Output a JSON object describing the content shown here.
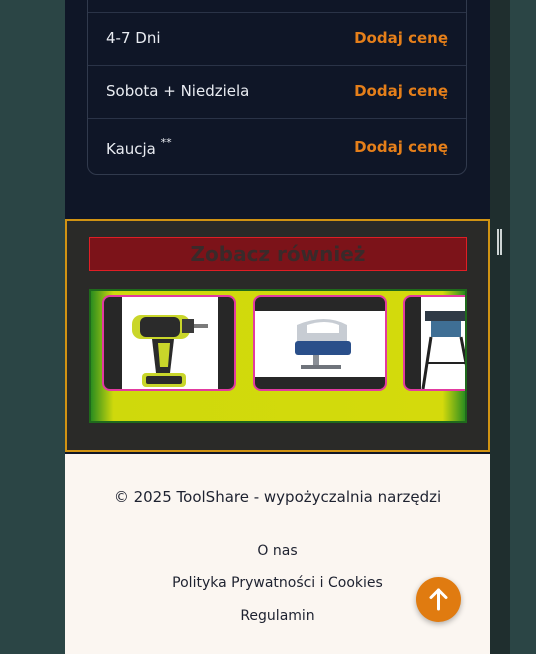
{
  "pricing": {
    "rows": [
      {
        "label": "4-7 Dni",
        "link": "Dodaj cenę"
      },
      {
        "label": "Sobota + Niedziela",
        "link": "Dodaj cenę"
      },
      {
        "label": "Kaucja",
        "note": "**",
        "link": "Dodaj cenę"
      }
    ]
  },
  "see_also": {
    "title": "Zobacz również",
    "products": [
      {
        "icon": "cordless-drill-image"
      },
      {
        "icon": "jigsaw-image"
      },
      {
        "icon": "table-saw-image"
      }
    ]
  },
  "footer": {
    "copyright": "© 2025 ToolShare - wypożyczalnia narzędzi",
    "links": [
      "O nas",
      "Polityka Prywatności i Cookies",
      "Regulamin"
    ]
  },
  "scroll_top": {
    "icon": "arrow-up-icon"
  },
  "colors": {
    "accent": "#e57f1a",
    "dark_bg": "#0f1627",
    "footer_bg": "#fbf6f1"
  }
}
